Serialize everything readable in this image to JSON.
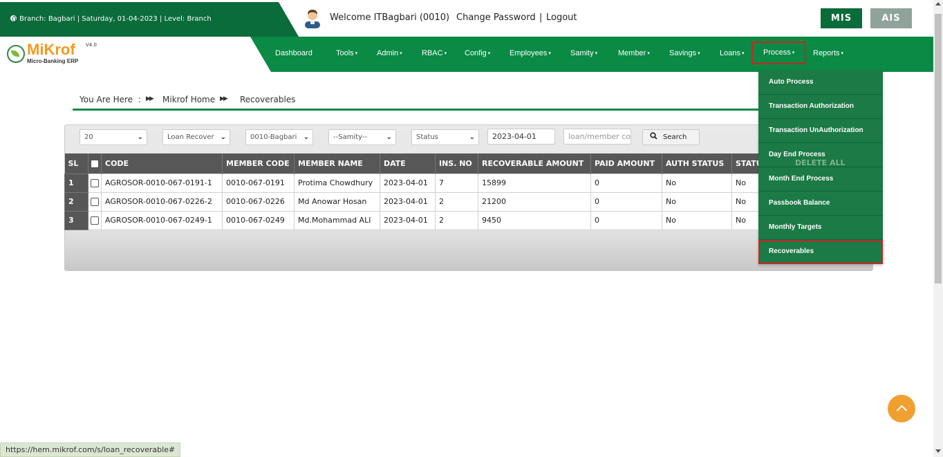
{
  "top": {
    "branch_info": "Branch: Bagbari | Saturday, 01-04-2023 | Level: Branch",
    "welcome": "Welcome ITBagbari (0010)",
    "change_password": "Change Password",
    "separator": "|",
    "logout": "Logout",
    "mis": "MIS",
    "ais": "AIS"
  },
  "logo": {
    "name": "MiKrof",
    "version": "V4.0",
    "tagline": "Micro-Banking ERP"
  },
  "nav": {
    "items": [
      {
        "label": "Dashboard"
      },
      {
        "label": "Tools"
      },
      {
        "label": "Admin"
      },
      {
        "label": "RBAC"
      },
      {
        "label": "Config"
      },
      {
        "label": "Employees"
      },
      {
        "label": "Samity"
      },
      {
        "label": "Member"
      },
      {
        "label": "Savings"
      },
      {
        "label": "Loans"
      },
      {
        "label": "Process"
      },
      {
        "label": "Reports"
      }
    ],
    "caret": "▾"
  },
  "process_menu": {
    "items": [
      {
        "label": "Auto Process"
      },
      {
        "label": "Transaction Authorization"
      },
      {
        "label": "Transaction UnAuthorization"
      },
      {
        "label": "Day End Process"
      },
      {
        "label": "Month End Process"
      },
      {
        "label": "Passbook Balance"
      },
      {
        "label": "Monthly Targets"
      },
      {
        "label": "Recoverables"
      }
    ],
    "selected": "Recoverables"
  },
  "breadcrumb": {
    "prefix": "You Are Here",
    "colon": ":",
    "home": "Mikrof Home",
    "current": "Recoverables",
    "arrow": "▶▶"
  },
  "filters": {
    "page_size": "20",
    "type": "Loan Recover",
    "branch": "0010-Bagbari",
    "samity": "--Samity--",
    "status": "Status",
    "date": "2023-04-01",
    "search_placeholder": "loan/member co",
    "search_label": "Search",
    "delete_all": "DELETE ALL"
  },
  "table": {
    "columns": [
      "SL",
      "CODE",
      "MEMBER CODE",
      "MEMBER NAME",
      "DATE",
      "INS. NO",
      "RECOVERABLE AMOUNT",
      "PAID AMOUNT",
      "AUTH STATUS",
      "STATUS"
    ],
    "rows": [
      {
        "sl": "1",
        "code": "AGROSOR-0010-067-0191-1",
        "member_code": "0010-067-0191",
        "member_name": "Protima Chowdhury",
        "date": "2023-04-01",
        "ins_no": "7",
        "recoverable": "15899",
        "paid": "0",
        "auth": "No",
        "status": "No"
      },
      {
        "sl": "2",
        "code": "AGROSOR-0010-067-0226-2",
        "member_code": "0010-067-0226",
        "member_name": "Md Anowar Hosan",
        "date": "2023-04-01",
        "ins_no": "2",
        "recoverable": "21200",
        "paid": "0",
        "auth": "No",
        "status": "No"
      },
      {
        "sl": "3",
        "code": "AGROSOR-0010-067-0249-1",
        "member_code": "0010-067-0249",
        "member_name": "Md.Mohammad ALI",
        "date": "2023-04-01",
        "ins_no": "2",
        "recoverable": "9450",
        "paid": "0",
        "auth": "No",
        "status": "No"
      }
    ]
  },
  "status_bar": {
    "url": "https://hem.mikrof.com/s/loan_recoverable#"
  },
  "colors": {
    "brand_green": "#0a8a45",
    "dark_green": "#0a6b3b",
    "logo_orange": "#f39a1c",
    "highlight_red": "#d42020",
    "to_top": "#f0a030"
  }
}
